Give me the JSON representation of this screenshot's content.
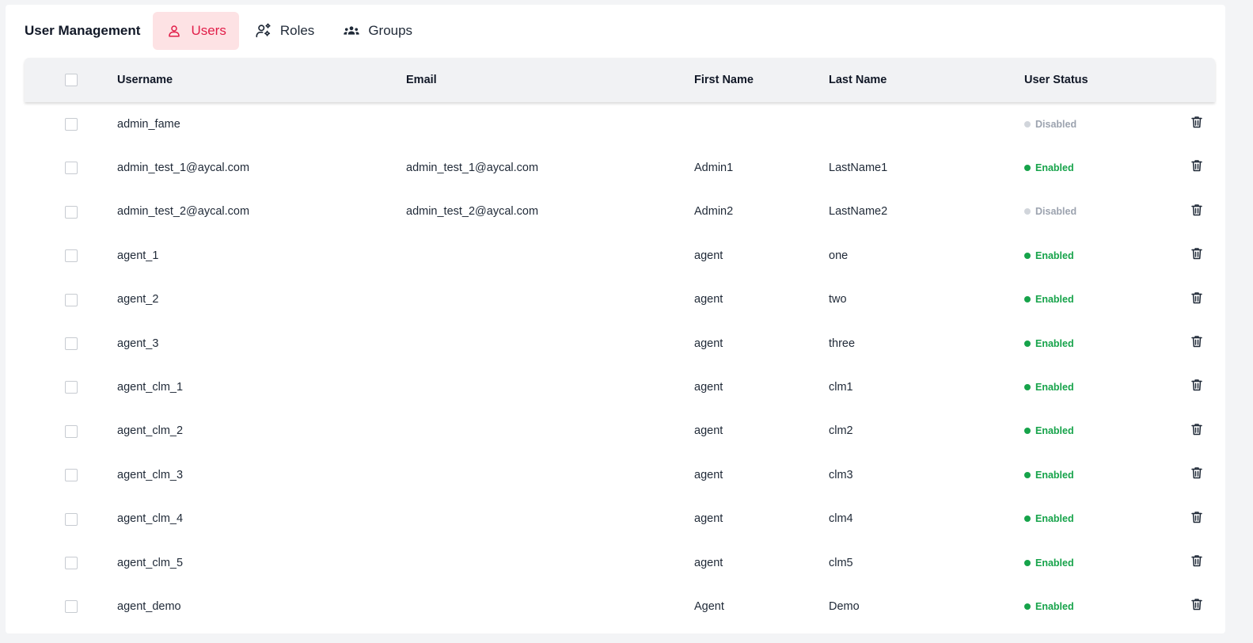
{
  "header": {
    "title": "User Management",
    "tabs": [
      {
        "label": "Users",
        "icon": "user-icon",
        "active": true
      },
      {
        "label": "Roles",
        "icon": "roles-icon",
        "active": false
      },
      {
        "label": "Groups",
        "icon": "groups-icon",
        "active": false
      }
    ]
  },
  "table": {
    "columns": [
      "Username",
      "Email",
      "First Name",
      "Last Name",
      "User Status"
    ],
    "rows": [
      {
        "username": "admin_fame",
        "email": "",
        "first_name": "",
        "last_name": "",
        "status": "Disabled"
      },
      {
        "username": "admin_test_1@aycal.com",
        "email": "admin_test_1@aycal.com",
        "first_name": "Admin1",
        "last_name": "LastName1",
        "status": "Enabled"
      },
      {
        "username": "admin_test_2@aycal.com",
        "email": "admin_test_2@aycal.com",
        "first_name": "Admin2",
        "last_name": "LastName2",
        "status": "Disabled"
      },
      {
        "username": "agent_1",
        "email": "",
        "first_name": "agent",
        "last_name": "one",
        "status": "Enabled"
      },
      {
        "username": "agent_2",
        "email": "",
        "first_name": "agent",
        "last_name": "two",
        "status": "Enabled"
      },
      {
        "username": "agent_3",
        "email": "",
        "first_name": "agent",
        "last_name": "three",
        "status": "Enabled"
      },
      {
        "username": "agent_clm_1",
        "email": "",
        "first_name": "agent",
        "last_name": "clm1",
        "status": "Enabled"
      },
      {
        "username": "agent_clm_2",
        "email": "",
        "first_name": "agent",
        "last_name": "clm2",
        "status": "Enabled"
      },
      {
        "username": "agent_clm_3",
        "email": "",
        "first_name": "agent",
        "last_name": "clm3",
        "status": "Enabled"
      },
      {
        "username": "agent_clm_4",
        "email": "",
        "first_name": "agent",
        "last_name": "clm4",
        "status": "Enabled"
      },
      {
        "username": "agent_clm_5",
        "email": "",
        "first_name": "agent",
        "last_name": "clm5",
        "status": "Enabled"
      },
      {
        "username": "agent_demo",
        "email": "",
        "first_name": "Agent",
        "last_name": "Demo",
        "status": "Enabled"
      }
    ]
  },
  "colors": {
    "accent": "#e11d48",
    "accent_bg": "#fde2e4",
    "enabled": "#16a34a",
    "disabled_text": "#9ca3af",
    "disabled_dot": "#d1d5db"
  }
}
